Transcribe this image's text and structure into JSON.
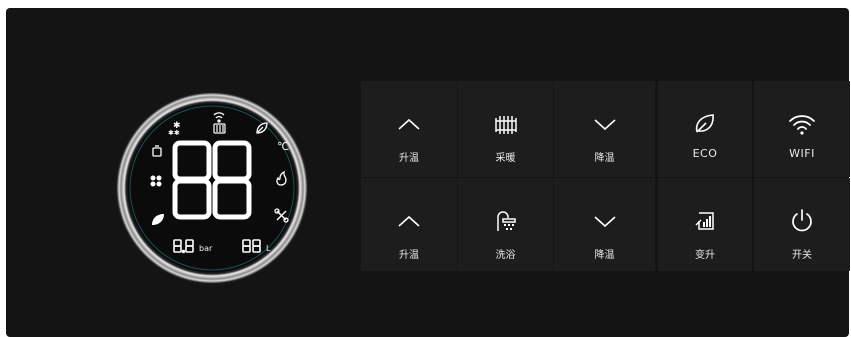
{
  "display": {
    "left_value": "8.8",
    "left_unit": "bar",
    "right_value": "88",
    "right_unit": "L",
    "temp_unit": "℃",
    "main_value": "88",
    "icons": [
      "snowflake-icon",
      "wifi-icon",
      "radiator-icon",
      "leaf-icon",
      "kettle-icon",
      "fan-icon",
      "flame-icon",
      "tools-icon",
      "eco-leaf-icon"
    ]
  },
  "buttons": {
    "up_heat_top": "升温",
    "heating": "采暖",
    "down_heat_top": "降温",
    "eco": "ECO",
    "wifi": "WIFI",
    "up_heat_bottom": "升温",
    "shower": "洗浴",
    "down_heat_bottom": "降温",
    "boost": "变升",
    "power": "开关"
  },
  "colors": {
    "panel": "#141414",
    "button": "#1d1d1d",
    "display_text": "#ffffff",
    "ring_glow": "#29c3c9"
  }
}
